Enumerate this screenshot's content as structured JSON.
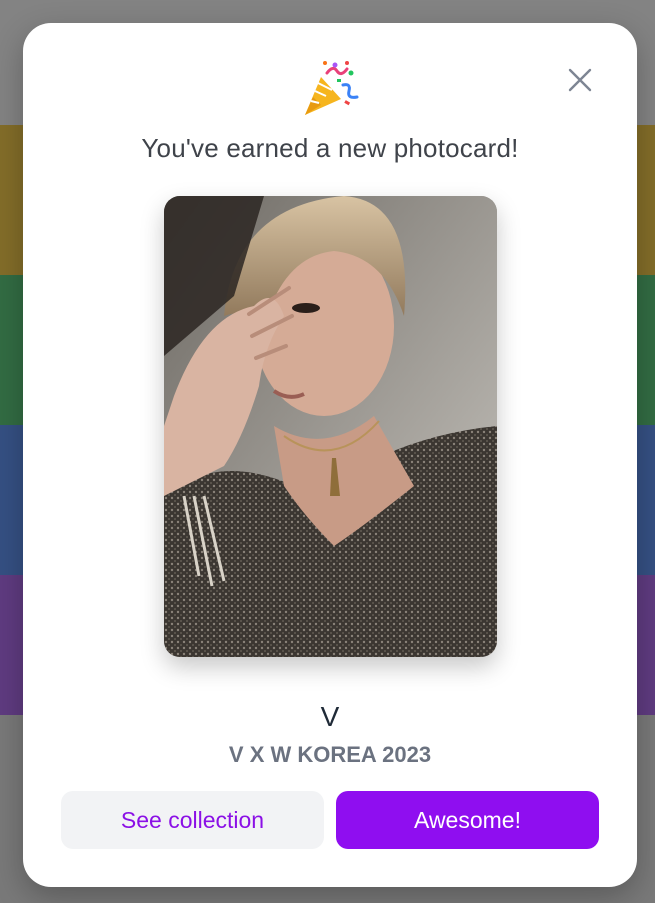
{
  "modal": {
    "title": "You've earned a new photocard!",
    "close_icon": "close-icon",
    "celebration_icon": "party-popper-icon"
  },
  "card": {
    "name": "V",
    "set": "V X W KOREA 2023",
    "image": "photocard-image"
  },
  "actions": {
    "secondary_label": "See collection",
    "primary_label": "Awesome!"
  },
  "colors": {
    "accent": "#8f0ef0",
    "accent_text": "#8b10e6",
    "secondary_bg": "#f2f3f5"
  }
}
